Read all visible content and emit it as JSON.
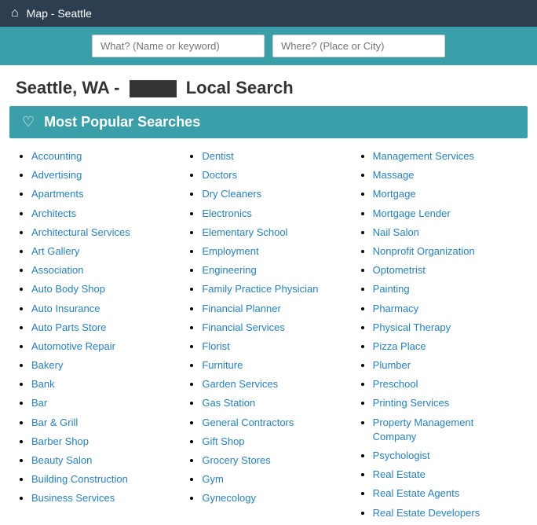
{
  "nav": {
    "home_icon": "⌂",
    "title": "Map - Seattle"
  },
  "search": {
    "what_placeholder": "What? (Name or keyword)",
    "where_placeholder": "Where? (Place or City)"
  },
  "page_title": {
    "prefix": "Seattle, WA -",
    "suffix": "Local Search"
  },
  "section": {
    "icon": "♡",
    "title": "Most Popular Searches"
  },
  "columns": [
    {
      "id": "col1",
      "items": [
        "Accounting",
        "Advertising",
        "Apartments",
        "Architects",
        "Architectural Services",
        "Art Gallery",
        "Association",
        "Auto Body Shop",
        "Auto Insurance",
        "Auto Parts Store",
        "Automotive Repair",
        "Bakery",
        "Bank",
        "Bar",
        "Bar & Grill",
        "Barber Shop",
        "Beauty Salon",
        "Building Construction",
        "Business Services"
      ]
    },
    {
      "id": "col2",
      "items": [
        "Dentist",
        "Doctors",
        "Dry Cleaners",
        "Electronics",
        "Elementary School",
        "Employment",
        "Engineering",
        "Family Practice Physician",
        "Financial Planner",
        "Financial Services",
        "Florist",
        "Furniture",
        "Garden Services",
        "Gas Station",
        "General Contractors",
        "Gift Shop",
        "Grocery Stores",
        "Gym",
        "Gynecology"
      ]
    },
    {
      "id": "col3",
      "items": [
        "Management Services",
        "Massage",
        "Mortgage",
        "Mortgage Lender",
        "Nail Salon",
        "Nonprofit Organization",
        "Optometrist",
        "Painting",
        "Pharmacy",
        "Physical Therapy",
        "Pizza Place",
        "Plumber",
        "Preschool",
        "Printing Services",
        "Property Management Company",
        "Psychologist",
        "Real Estate",
        "Real Estate Agents",
        "Real Estate Developers"
      ]
    }
  ]
}
